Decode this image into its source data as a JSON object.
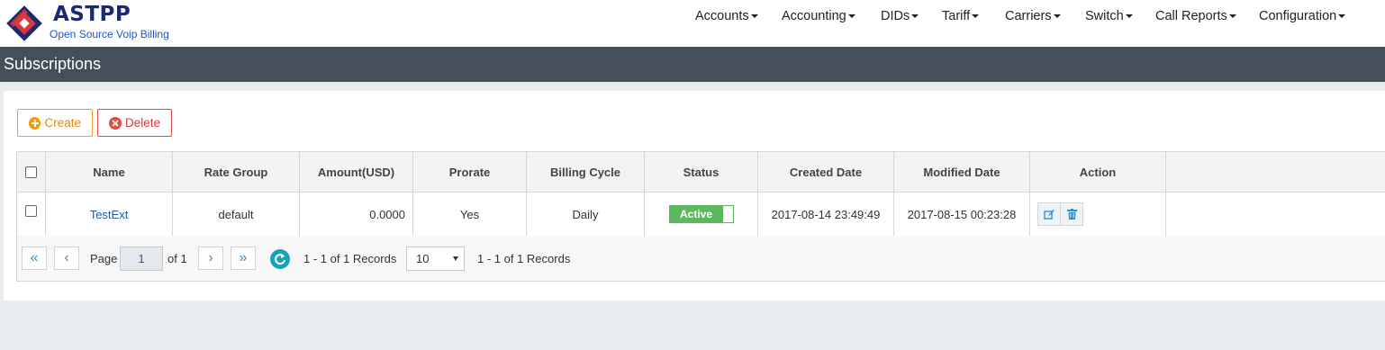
{
  "brand": {
    "title": "ASTPP",
    "subtitle": "Open Source Voip Billing"
  },
  "nav": [
    "Accounts",
    "Accounting",
    "DIDs",
    "Tariff",
    "Carriers",
    "Switch",
    "Call Reports",
    "Configuration"
  ],
  "page_title": "Subscriptions",
  "toolbar": {
    "create_label": "Create",
    "delete_label": "Delete"
  },
  "table": {
    "headers": [
      "Name",
      "Rate Group",
      "Amount(USD)",
      "Prorate",
      "Billing Cycle",
      "Status",
      "Created Date",
      "Modified Date",
      "Action"
    ],
    "rows": [
      {
        "name": "TestExt",
        "rate_group": "default",
        "amount": "0.0000",
        "prorate": "Yes",
        "billing_cycle": "Daily",
        "status": "Active",
        "created": "2017-08-14 23:49:49",
        "modified": "2017-08-15 00:23:28"
      }
    ]
  },
  "pagination": {
    "page_label": "Page",
    "page_value": "1",
    "of_label": "of 1",
    "records_text": "1 - 1 of 1 Records",
    "per_page": "10",
    "records_text_2": "1 - 1 of 1 Records"
  },
  "colors": {
    "header_dark": "#454e5b",
    "create": "#f39c12",
    "delete": "#e74c3c",
    "active": "#5cb85c",
    "link": "#1e5aa8",
    "refresh": "#16a5b8"
  },
  "icons": [
    "logo-mark",
    "plus-circle-icon",
    "times-circle-icon",
    "edit-icon",
    "trash-icon",
    "refresh-icon",
    "first-page-icon",
    "prev-page-icon",
    "next-page-icon",
    "last-page-icon"
  ]
}
